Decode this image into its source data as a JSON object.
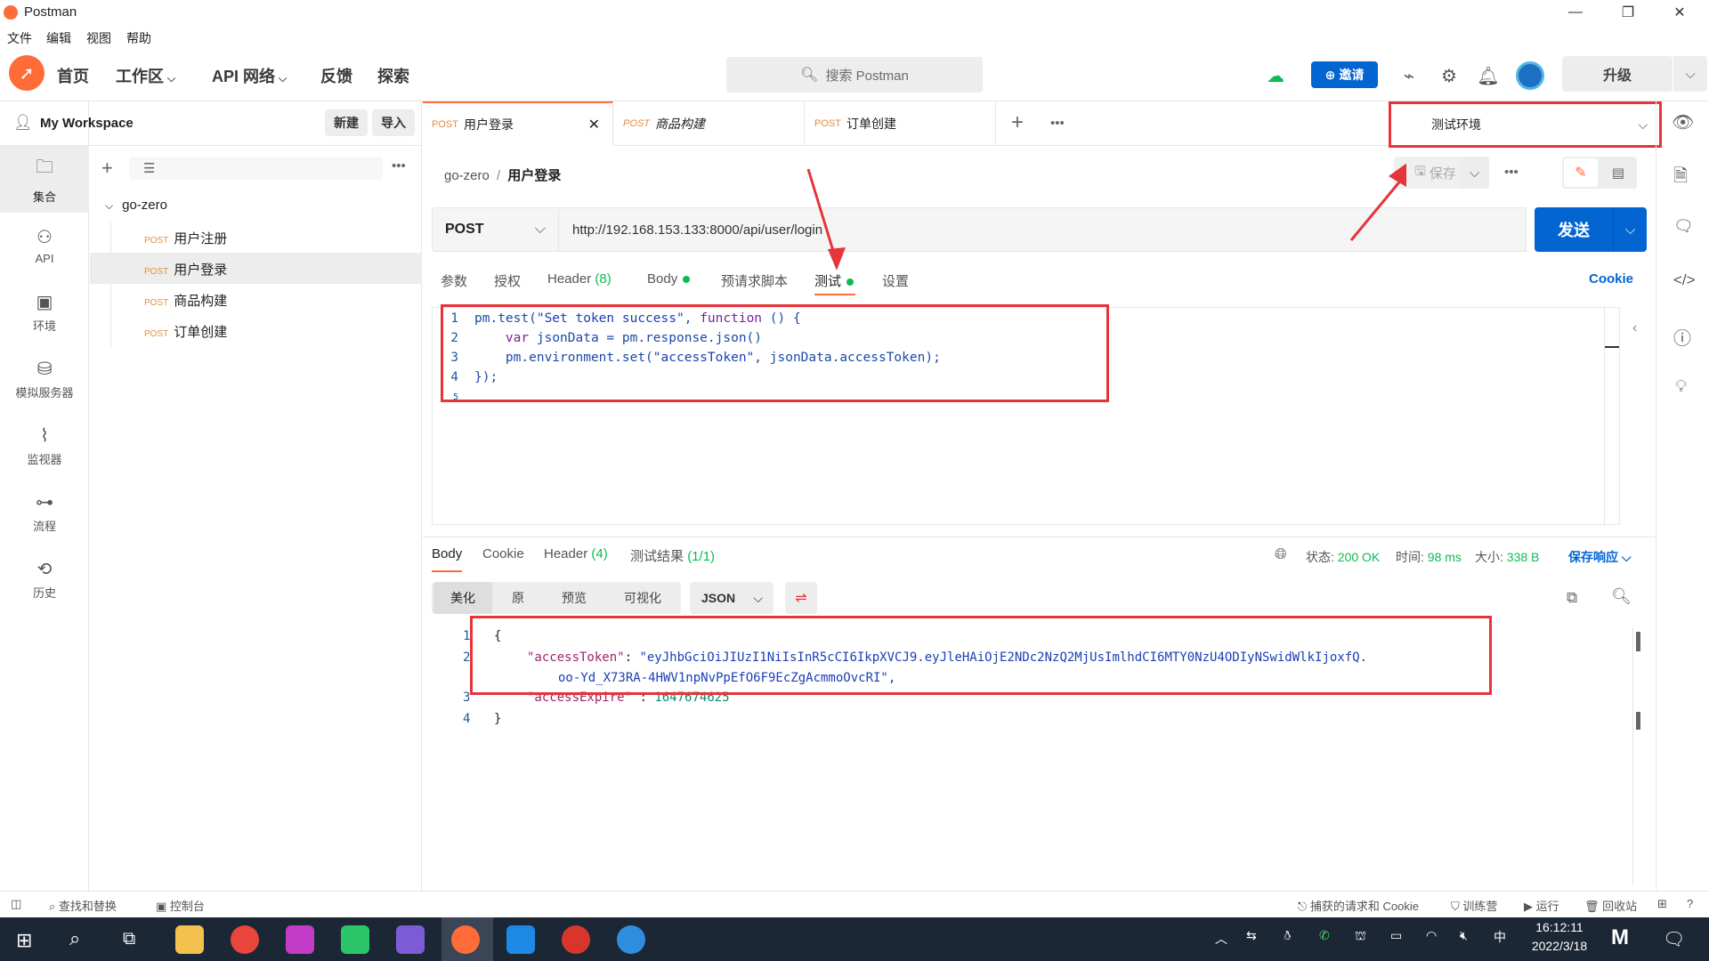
{
  "app": {
    "title": "Postman"
  },
  "menu": [
    "文件",
    "编辑",
    "视图",
    "帮助"
  ],
  "nav": {
    "home": "首页",
    "workspace": "工作区",
    "api_network": "API 网络",
    "feedback": "反馈",
    "explore": "探索"
  },
  "search": {
    "placeholder": "搜索 Postman"
  },
  "toolbar": {
    "invite": "邀请",
    "upgrade": "升级"
  },
  "workspace": {
    "name": "My Workspace",
    "new": "新建",
    "import": "导入"
  },
  "rail": [
    {
      "label": "集合",
      "icon": "collections-icon"
    },
    {
      "label": "API",
      "icon": "api-icon"
    },
    {
      "label": "环境",
      "icon": "environment-icon"
    },
    {
      "label": "模拟服务器",
      "icon": "mock-server-icon"
    },
    {
      "label": "监视器",
      "icon": "monitor-icon"
    },
    {
      "label": "流程",
      "icon": "flows-icon"
    },
    {
      "label": "历史",
      "icon": "history-icon"
    }
  ],
  "collection": {
    "name": "go-zero",
    "requests": [
      {
        "method": "POST",
        "name": "用户注册"
      },
      {
        "method": "POST",
        "name": "用户登录"
      },
      {
        "method": "POST",
        "name": "商品构建"
      },
      {
        "method": "POST",
        "name": "订单创建"
      }
    ]
  },
  "tabs": [
    {
      "method": "POST",
      "name": "用户登录"
    },
    {
      "method": "POST",
      "name": "商品构建"
    },
    {
      "method": "POST",
      "name": "订单创建"
    }
  ],
  "environment": {
    "selected": "测试环境"
  },
  "breadcrumb": {
    "collection": "go-zero",
    "sep": "/",
    "request": "用户登录"
  },
  "actions": {
    "save": "保存"
  },
  "request": {
    "method": "POST",
    "url": "http://192.168.153.133:8000/api/user/login",
    "send": "发送",
    "tabs": {
      "params": "参数",
      "auth": "授权",
      "headers": "Header",
      "headers_count": "(8)",
      "body": "Body",
      "prerequest": "预请求脚本",
      "tests": "测试",
      "settings": "设置"
    },
    "cookie": "Cookie"
  },
  "tests_code": [
    {
      "n": "1",
      "text": "pm.test(\"Set token success\", function () {"
    },
    {
      "n": "2",
      "text": "    var jsonData = pm.response.json()"
    },
    {
      "n": "3",
      "text": "    pm.environment.set(\"accessToken\", jsonData.accessToken);"
    },
    {
      "n": "4",
      "text": "});"
    },
    {
      "n": "5",
      "text": ""
    }
  ],
  "response": {
    "tabs": {
      "body": "Body",
      "cookie": "Cookie",
      "headers": "Header",
      "headers_count": "(4)",
      "test_results": "测试结果",
      "test_count": "(1/1)"
    },
    "status_label": "状态:",
    "status": "200 OK",
    "time_label": "时间:",
    "time": "98 ms",
    "size_label": "大小:",
    "size": "338 B",
    "save": "保存响应",
    "views": {
      "pretty": "美化",
      "raw": "原",
      "preview": "预览",
      "visualize": "可视化"
    },
    "format": "JSON",
    "body": {
      "l1": "{",
      "token_key": "\"accessToken\"",
      "token_val1": "\"eyJhbGciOiJIUzI1NiIsInR5cCI6IkpXVCJ9.eyJleHAiOjE2NDc2NzQ2MjUsImlhdCI6MTY0NzU4ODIyNSwidWlkIjoxfQ.",
      "token_val2": "oo-Yd_X73RA-4HWV1npNvPpEfO6F9EcZgAcmmoOvcRI\",",
      "expire_key": "\"accessExpire\"",
      "expire_val": "1647674625",
      "l4": "}"
    }
  },
  "statusbar": {
    "find": "查找和替换",
    "console": "控制台",
    "capture": "捕获的请求和 Cookie",
    "bootcamp": "训练营",
    "runner": "运行",
    "trash": "回收站"
  },
  "taskbar": {
    "time": "16:12:11",
    "date": "2022/3/18",
    "ime": "中"
  },
  "colors": {
    "accent": "#ff6c37",
    "primary": "#0265d2",
    "success": "#0cbb52",
    "highlight": "#e6343a"
  }
}
